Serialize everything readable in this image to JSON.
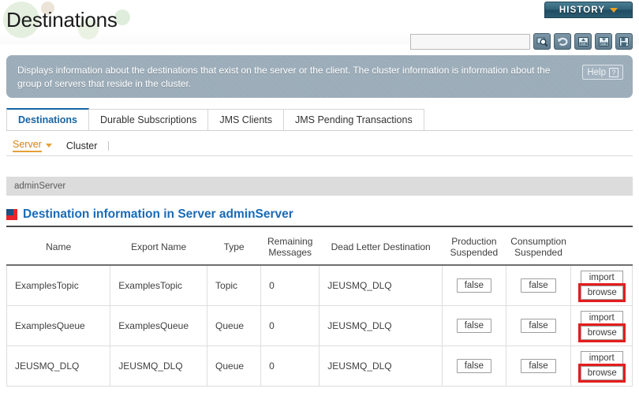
{
  "header": {
    "page_title": "Destinations",
    "history_button": "HISTORY",
    "history_caret_icon": "chevron-down-icon",
    "search_value": "",
    "search_placeholder": "",
    "toolbar_icons": [
      {
        "name": "search-icon",
        "label": "Search"
      },
      {
        "name": "refresh-icon",
        "label": "Refresh"
      },
      {
        "name": "xml-upload-icon",
        "label": "Import XML"
      },
      {
        "name": "xml-download-icon",
        "label": "Export XML"
      },
      {
        "name": "save-export-icon",
        "label": "Save"
      }
    ]
  },
  "info": {
    "text": "Displays information about the destinations that exist on the server or the client. The cluster information is information about the group of servers that reside in the cluster.",
    "help_label": "Help",
    "help_icon": "question-mark-icon"
  },
  "tabs": [
    {
      "label": "Destinations",
      "active": true
    },
    {
      "label": "Durable Subscriptions",
      "active": false
    },
    {
      "label": "JMS Clients",
      "active": false
    },
    {
      "label": "JMS Pending Transactions",
      "active": false
    }
  ],
  "subtabs": [
    {
      "label": "Server",
      "active": true,
      "caret_icon": "caret-down-icon"
    },
    {
      "label": "Cluster",
      "active": false
    }
  ],
  "breadcrumb": "adminServer",
  "section": {
    "icon": "jeus-square-icon",
    "title": "Destination information in Server adminServer"
  },
  "table": {
    "columns": [
      "Name",
      "Export Name",
      "Type",
      "Remaining Messages",
      "Dead Letter Destination",
      "Production Suspended",
      "Consumption Suspended",
      ""
    ],
    "columns_split": [
      [
        "Name"
      ],
      [
        "Export Name"
      ],
      [
        "Type"
      ],
      [
        "Remaining",
        "Messages"
      ],
      [
        "Dead Letter Destination"
      ],
      [
        "Production",
        "Suspended"
      ],
      [
        "Consumption",
        "Suspended"
      ],
      [
        ""
      ]
    ],
    "rows": [
      {
        "name": "ExamplesTopic",
        "export_name": "ExamplesTopic",
        "type": "Topic",
        "remaining_messages": "0",
        "dead_letter_destination": "JEUSMQ_DLQ",
        "production_suspended": "false",
        "consumption_suspended": "false",
        "import_label": "import",
        "browse_label": "browse",
        "browse_highlighted": true
      },
      {
        "name": "ExamplesQueue",
        "export_name": "ExamplesQueue",
        "type": "Queue",
        "remaining_messages": "0",
        "dead_letter_destination": "JEUSMQ_DLQ",
        "production_suspended": "false",
        "consumption_suspended": "false",
        "import_label": "import",
        "browse_label": "browse",
        "browse_highlighted": true
      },
      {
        "name": "JEUSMQ_DLQ",
        "export_name": "JEUSMQ_DLQ",
        "type": "Queue",
        "remaining_messages": "0",
        "dead_letter_destination": "JEUSMQ_DLQ",
        "production_suspended": "false",
        "consumption_suspended": "false",
        "import_label": "import",
        "browse_label": "browse",
        "browse_highlighted": true
      }
    ]
  },
  "colors": {
    "accent_blue": "#1a6bb5",
    "active_orange": "#d98316",
    "history_teal": "#2f6177",
    "info_panel": "#9aabb8",
    "highlight_red": "#e41d1d"
  }
}
